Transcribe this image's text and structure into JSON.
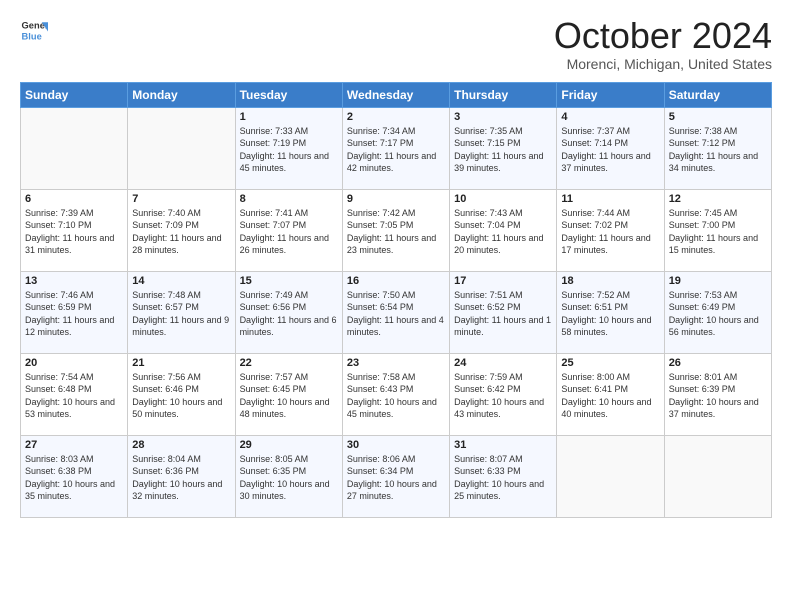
{
  "header": {
    "logo_line1": "General",
    "logo_line2": "Blue",
    "title": "October 2024",
    "subtitle": "Morenci, Michigan, United States"
  },
  "days_of_week": [
    "Sunday",
    "Monday",
    "Tuesday",
    "Wednesday",
    "Thursday",
    "Friday",
    "Saturday"
  ],
  "weeks": [
    [
      {
        "day": "",
        "info": ""
      },
      {
        "day": "",
        "info": ""
      },
      {
        "day": "1",
        "info": "Sunrise: 7:33 AM\nSunset: 7:19 PM\nDaylight: 11 hours and 45 minutes."
      },
      {
        "day": "2",
        "info": "Sunrise: 7:34 AM\nSunset: 7:17 PM\nDaylight: 11 hours and 42 minutes."
      },
      {
        "day": "3",
        "info": "Sunrise: 7:35 AM\nSunset: 7:15 PM\nDaylight: 11 hours and 39 minutes."
      },
      {
        "day": "4",
        "info": "Sunrise: 7:37 AM\nSunset: 7:14 PM\nDaylight: 11 hours and 37 minutes."
      },
      {
        "day": "5",
        "info": "Sunrise: 7:38 AM\nSunset: 7:12 PM\nDaylight: 11 hours and 34 minutes."
      }
    ],
    [
      {
        "day": "6",
        "info": "Sunrise: 7:39 AM\nSunset: 7:10 PM\nDaylight: 11 hours and 31 minutes."
      },
      {
        "day": "7",
        "info": "Sunrise: 7:40 AM\nSunset: 7:09 PM\nDaylight: 11 hours and 28 minutes."
      },
      {
        "day": "8",
        "info": "Sunrise: 7:41 AM\nSunset: 7:07 PM\nDaylight: 11 hours and 26 minutes."
      },
      {
        "day": "9",
        "info": "Sunrise: 7:42 AM\nSunset: 7:05 PM\nDaylight: 11 hours and 23 minutes."
      },
      {
        "day": "10",
        "info": "Sunrise: 7:43 AM\nSunset: 7:04 PM\nDaylight: 11 hours and 20 minutes."
      },
      {
        "day": "11",
        "info": "Sunrise: 7:44 AM\nSunset: 7:02 PM\nDaylight: 11 hours and 17 minutes."
      },
      {
        "day": "12",
        "info": "Sunrise: 7:45 AM\nSunset: 7:00 PM\nDaylight: 11 hours and 15 minutes."
      }
    ],
    [
      {
        "day": "13",
        "info": "Sunrise: 7:46 AM\nSunset: 6:59 PM\nDaylight: 11 hours and 12 minutes."
      },
      {
        "day": "14",
        "info": "Sunrise: 7:48 AM\nSunset: 6:57 PM\nDaylight: 11 hours and 9 minutes."
      },
      {
        "day": "15",
        "info": "Sunrise: 7:49 AM\nSunset: 6:56 PM\nDaylight: 11 hours and 6 minutes."
      },
      {
        "day": "16",
        "info": "Sunrise: 7:50 AM\nSunset: 6:54 PM\nDaylight: 11 hours and 4 minutes."
      },
      {
        "day": "17",
        "info": "Sunrise: 7:51 AM\nSunset: 6:52 PM\nDaylight: 11 hours and 1 minute."
      },
      {
        "day": "18",
        "info": "Sunrise: 7:52 AM\nSunset: 6:51 PM\nDaylight: 10 hours and 58 minutes."
      },
      {
        "day": "19",
        "info": "Sunrise: 7:53 AM\nSunset: 6:49 PM\nDaylight: 10 hours and 56 minutes."
      }
    ],
    [
      {
        "day": "20",
        "info": "Sunrise: 7:54 AM\nSunset: 6:48 PM\nDaylight: 10 hours and 53 minutes."
      },
      {
        "day": "21",
        "info": "Sunrise: 7:56 AM\nSunset: 6:46 PM\nDaylight: 10 hours and 50 minutes."
      },
      {
        "day": "22",
        "info": "Sunrise: 7:57 AM\nSunset: 6:45 PM\nDaylight: 10 hours and 48 minutes."
      },
      {
        "day": "23",
        "info": "Sunrise: 7:58 AM\nSunset: 6:43 PM\nDaylight: 10 hours and 45 minutes."
      },
      {
        "day": "24",
        "info": "Sunrise: 7:59 AM\nSunset: 6:42 PM\nDaylight: 10 hours and 43 minutes."
      },
      {
        "day": "25",
        "info": "Sunrise: 8:00 AM\nSunset: 6:41 PM\nDaylight: 10 hours and 40 minutes."
      },
      {
        "day": "26",
        "info": "Sunrise: 8:01 AM\nSunset: 6:39 PM\nDaylight: 10 hours and 37 minutes."
      }
    ],
    [
      {
        "day": "27",
        "info": "Sunrise: 8:03 AM\nSunset: 6:38 PM\nDaylight: 10 hours and 35 minutes."
      },
      {
        "day": "28",
        "info": "Sunrise: 8:04 AM\nSunset: 6:36 PM\nDaylight: 10 hours and 32 minutes."
      },
      {
        "day": "29",
        "info": "Sunrise: 8:05 AM\nSunset: 6:35 PM\nDaylight: 10 hours and 30 minutes."
      },
      {
        "day": "30",
        "info": "Sunrise: 8:06 AM\nSunset: 6:34 PM\nDaylight: 10 hours and 27 minutes."
      },
      {
        "day": "31",
        "info": "Sunrise: 8:07 AM\nSunset: 6:33 PM\nDaylight: 10 hours and 25 minutes."
      },
      {
        "day": "",
        "info": ""
      },
      {
        "day": "",
        "info": ""
      }
    ]
  ]
}
